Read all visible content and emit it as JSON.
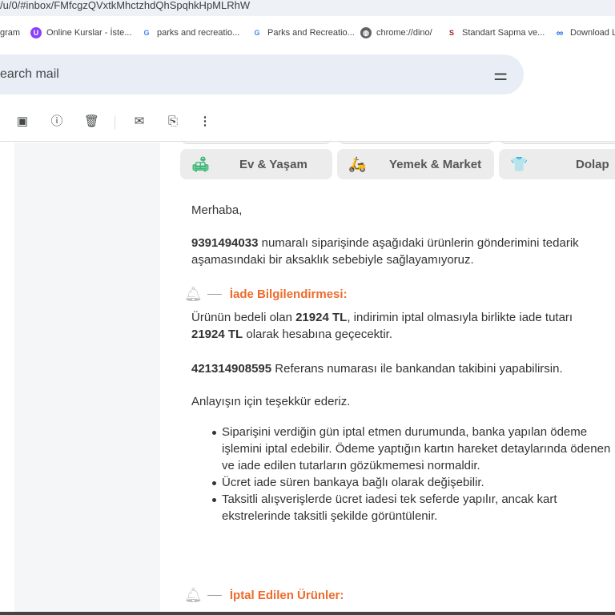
{
  "browser": {
    "url": "/u/0/#inbox/FMfcgzQVxtkMhctzhdQhSpqhkHpMLRhW",
    "bookmarks": [
      {
        "label": "gram"
      },
      {
        "label": "Online Kurslar - İste..."
      },
      {
        "label": "parks and recreatio..."
      },
      {
        "label": "Parks and Recreatio..."
      },
      {
        "label": "chrome://dino/"
      },
      {
        "label": "Standart Sapma ve..."
      },
      {
        "label": "Download L"
      }
    ]
  },
  "search": {
    "placeholder": "earch mail"
  },
  "toolbar": {
    "icons": [
      "archive-icon",
      "report-spam-icon",
      "delete-icon",
      "mark-unread-icon",
      "move-to-icon",
      "more-icon"
    ]
  },
  "email": {
    "categories": [
      {
        "label": "Ev & Yaşam",
        "color": "#3cb878"
      },
      {
        "label": "Yemek & Market",
        "color": "#ee6b2a"
      },
      {
        "label": "Dolap",
        "color": "#2ec4a6"
      }
    ],
    "greeting": "Merhaba,",
    "order_number": "9391494033",
    "order_text": " numaralı siparişinde aşağıdaki ürünlerin gönderimini tedarik aşamasındaki bir aksaklık sebebiyle sağlayamıyoruz.",
    "refund_heading": "İade Bilgilendirmesi:",
    "refund_p1": "Ürünün bedeli olan ",
    "amount": "21924 TL",
    "refund_p2": ", indirimin iptal olmasıyla birlikte iade tutarı",
    "refund_p3": " olarak hesabına geçecektir.",
    "reference_number": "421314908595",
    "reference_text": " Referans numarası ile bankandan takibini yapabilirsin.",
    "thanks": "Anlayışın için teşekkür ederiz.",
    "bullets": [
      "Siparişini verdiğin gün iptal etmen durumunda, banka yapılan ödeme işlemini iptal edebilir. Ödeme yaptığın kartın hareket detaylarında ödenen ve iade edilen tutarların gözükmemesi normaldir.",
      "Ücret iade süren bankaya bağlı olarak değişebilir.",
      "Taksitli alışverişlerde ücret iadesi tek seferde yapılır, ancak kart ekstrelerinde taksitli şekilde görüntülenir."
    ],
    "cancelled_heading": "İptal Edilen Ürünler:",
    "accent": "#ee6b2a"
  }
}
